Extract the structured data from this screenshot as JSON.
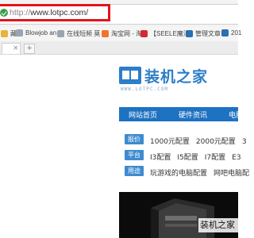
{
  "address_bar": {
    "url_protocol": "http://",
    "url_host": "www.lotpc.com/"
  },
  "bookmarks": [
    {
      "label": "藏",
      "icon": "bookmark-icon",
      "color": "#e8b33a"
    },
    {
      "label": "Blowjob an",
      "icon": "page-icon",
      "color": "#9aa4b1"
    },
    {
      "label": "在线短频 莫",
      "icon": "page-icon",
      "color": "#9aa4b1"
    },
    {
      "label": "淘宝网 - 淘",
      "icon": "taobao-icon",
      "color": "#f4742b"
    },
    {
      "label": "【SEELE魔法",
      "icon": "jd-icon",
      "color": "#d8282f"
    },
    {
      "label": "管理文章",
      "icon": "wordpress-icon",
      "color": "#2a6fb0"
    },
    {
      "label": "201",
      "icon": "page-icon",
      "color": "#2a6fb0"
    }
  ],
  "tab": {
    "close": "×",
    "new_tab": "+"
  },
  "site": {
    "logo_text": "装机之家",
    "logo_sub": "WWW.LOTPC.COM",
    "nav": [
      "网站首页",
      "硬件资讯",
      "电脑"
    ],
    "rows": [
      {
        "tag": "报价",
        "items": [
          "1000元配置",
          "2000元配置",
          "3"
        ]
      },
      {
        "tag": "平台",
        "items": [
          "I3配置",
          "I5配置",
          "I7配置",
          "E3"
        ]
      },
      {
        "tag": "用途",
        "items": [
          "玩游戏的电脑配置",
          "网吧电脑配"
        ]
      }
    ],
    "watermark": "装机之家"
  }
}
